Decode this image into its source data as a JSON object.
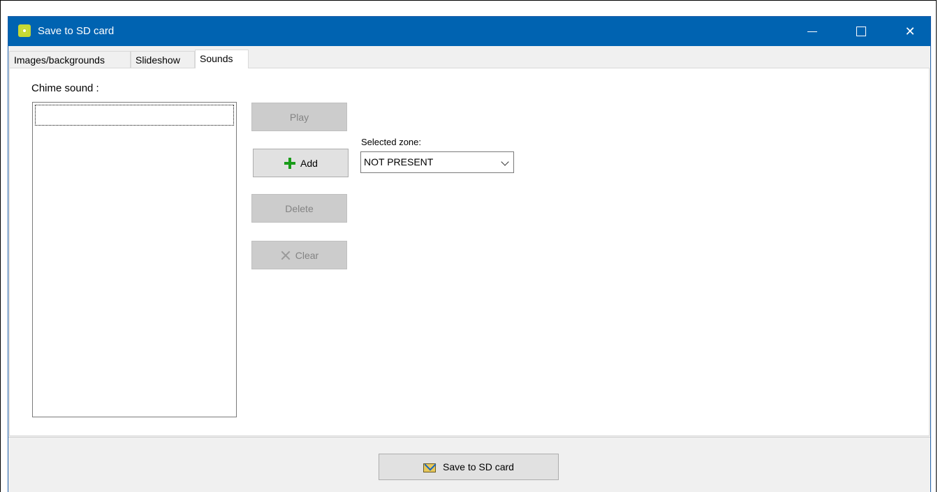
{
  "window": {
    "title": "Save to SD card",
    "controls": {
      "minimize": "minimize-icon",
      "maximize": "maximize-icon",
      "close": "close-icon"
    }
  },
  "tabs": [
    {
      "label": "Images/backgrounds",
      "active": false
    },
    {
      "label": "Slideshow",
      "active": false
    },
    {
      "label": "Sounds",
      "active": true
    }
  ],
  "sounds": {
    "chime_label": "Chime sound :",
    "chime_items": [],
    "buttons": {
      "play": {
        "label": "Play",
        "enabled": false
      },
      "add": {
        "label": "Add",
        "enabled": true,
        "icon": "plus-icon"
      },
      "delete": {
        "label": "Delete",
        "enabled": false
      },
      "clear": {
        "label": "Clear",
        "enabled": false,
        "icon": "clear-x-icon"
      }
    },
    "selected_zone": {
      "label": "Selected zone:",
      "value": "NOT PRESENT"
    }
  },
  "footer": {
    "save_label": "Save to SD card",
    "save_icon": "save-to-card-icon"
  },
  "colors": {
    "titlebar": "#0063b1",
    "add_plus": "#1a9c1a"
  }
}
